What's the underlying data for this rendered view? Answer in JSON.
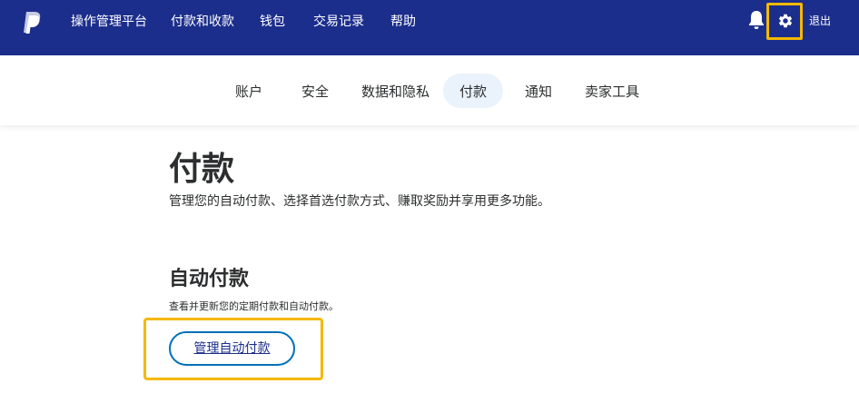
{
  "header": {
    "nav": [
      {
        "label": "操作管理平台"
      },
      {
        "label": "付款和收款"
      },
      {
        "label": "钱包"
      },
      {
        "label": "交易记录"
      },
      {
        "label": "帮助"
      }
    ],
    "logout_label": "退出",
    "icons": {
      "logo": "paypal-logo-icon",
      "bell": "bell-icon",
      "gear": "gear-icon"
    },
    "highlight_color": "#f5b800",
    "background_color": "#1c2e8c"
  },
  "subnav": {
    "tabs": [
      {
        "label": "账户"
      },
      {
        "label": "安全"
      },
      {
        "label": "数据和隐私"
      },
      {
        "label": "付款"
      },
      {
        "label": "通知"
      },
      {
        "label": "卖家工具"
      }
    ],
    "active_tab": "付款"
  },
  "main": {
    "title": "付款",
    "description": "管理您的自动付款、选择首选付款方式、赚取奖励并享用更多功能。",
    "section": {
      "title": "自动付款",
      "description": "查看并更新您的定期付款和自动付款。",
      "button_label": "管理自动付款"
    }
  }
}
